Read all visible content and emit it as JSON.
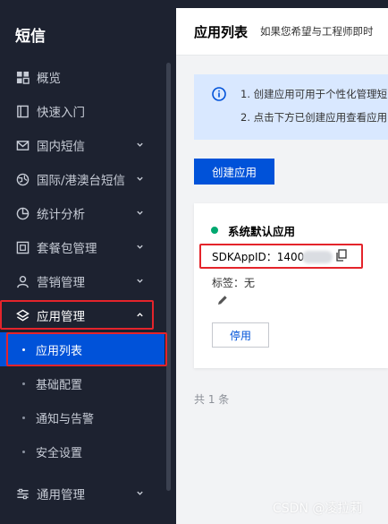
{
  "sidebar": {
    "title": "短信",
    "items": [
      {
        "label": "概览",
        "icon": "grid-icon",
        "chevron": false
      },
      {
        "label": "快速入门",
        "icon": "book-icon",
        "chevron": false
      },
      {
        "label": "国内短信",
        "icon": "mail-icon",
        "chevron": true
      },
      {
        "label": "国际/港澳台短信",
        "icon": "globe-icon",
        "chevron": true
      },
      {
        "label": "统计分析",
        "icon": "pie-chart-icon",
        "chevron": true
      },
      {
        "label": "套餐包管理",
        "icon": "package-icon",
        "chevron": true
      },
      {
        "label": "营销管理",
        "icon": "user-icon",
        "chevron": true
      },
      {
        "label": "应用管理",
        "icon": "layers-icon",
        "chevron": true,
        "expanded": true
      }
    ],
    "sub_items": [
      {
        "label": "应用列表",
        "active": true
      },
      {
        "label": "基础配置",
        "active": false
      },
      {
        "label": "通知与告警",
        "active": false
      },
      {
        "label": "安全设置",
        "active": false
      }
    ],
    "bottom_item": {
      "label": "通用管理",
      "icon": "sliders-icon",
      "chevron": true
    }
  },
  "header": {
    "title": "应用列表",
    "subtitle": "如果您希望与工程师即时"
  },
  "notice": {
    "line1": "1. 创建应用可用于个性化管理短",
    "line2": "2. 点击下方已创建应用查看应用"
  },
  "create_button": "创建应用",
  "app_card": {
    "name": "系统默认应用",
    "status_color": "#00a870",
    "appid_label": "SDKAppID：",
    "appid_value": "1400",
    "tag_text": "标签：无",
    "disable_button": "停用"
  },
  "total_text": "共 1 条",
  "watermark": "CSDN @凌拉莉",
  "colors": {
    "accent": "#0052d9",
    "sidebar_bg": "#1d2230",
    "highlight": "#e4242b"
  }
}
